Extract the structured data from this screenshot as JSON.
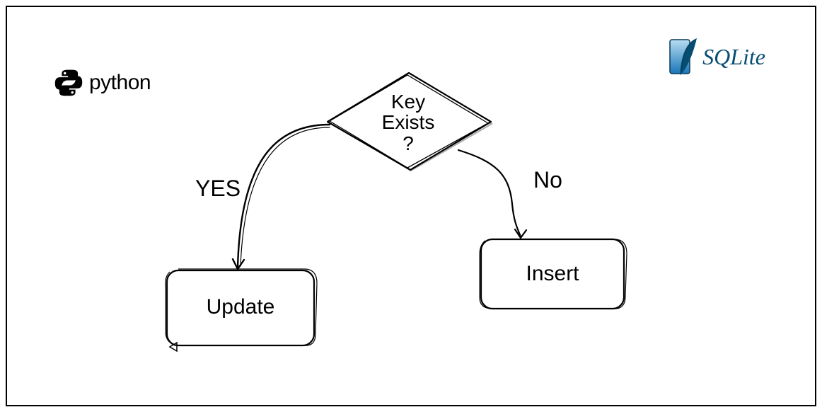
{
  "logos": {
    "python": "python",
    "sqlite": "SQLite"
  },
  "decision": {
    "line1": "Key",
    "line2": "Exists",
    "line3": "?"
  },
  "edges": {
    "yes": "YES",
    "no": "No"
  },
  "nodes": {
    "update": "Update",
    "insert": "Insert"
  }
}
